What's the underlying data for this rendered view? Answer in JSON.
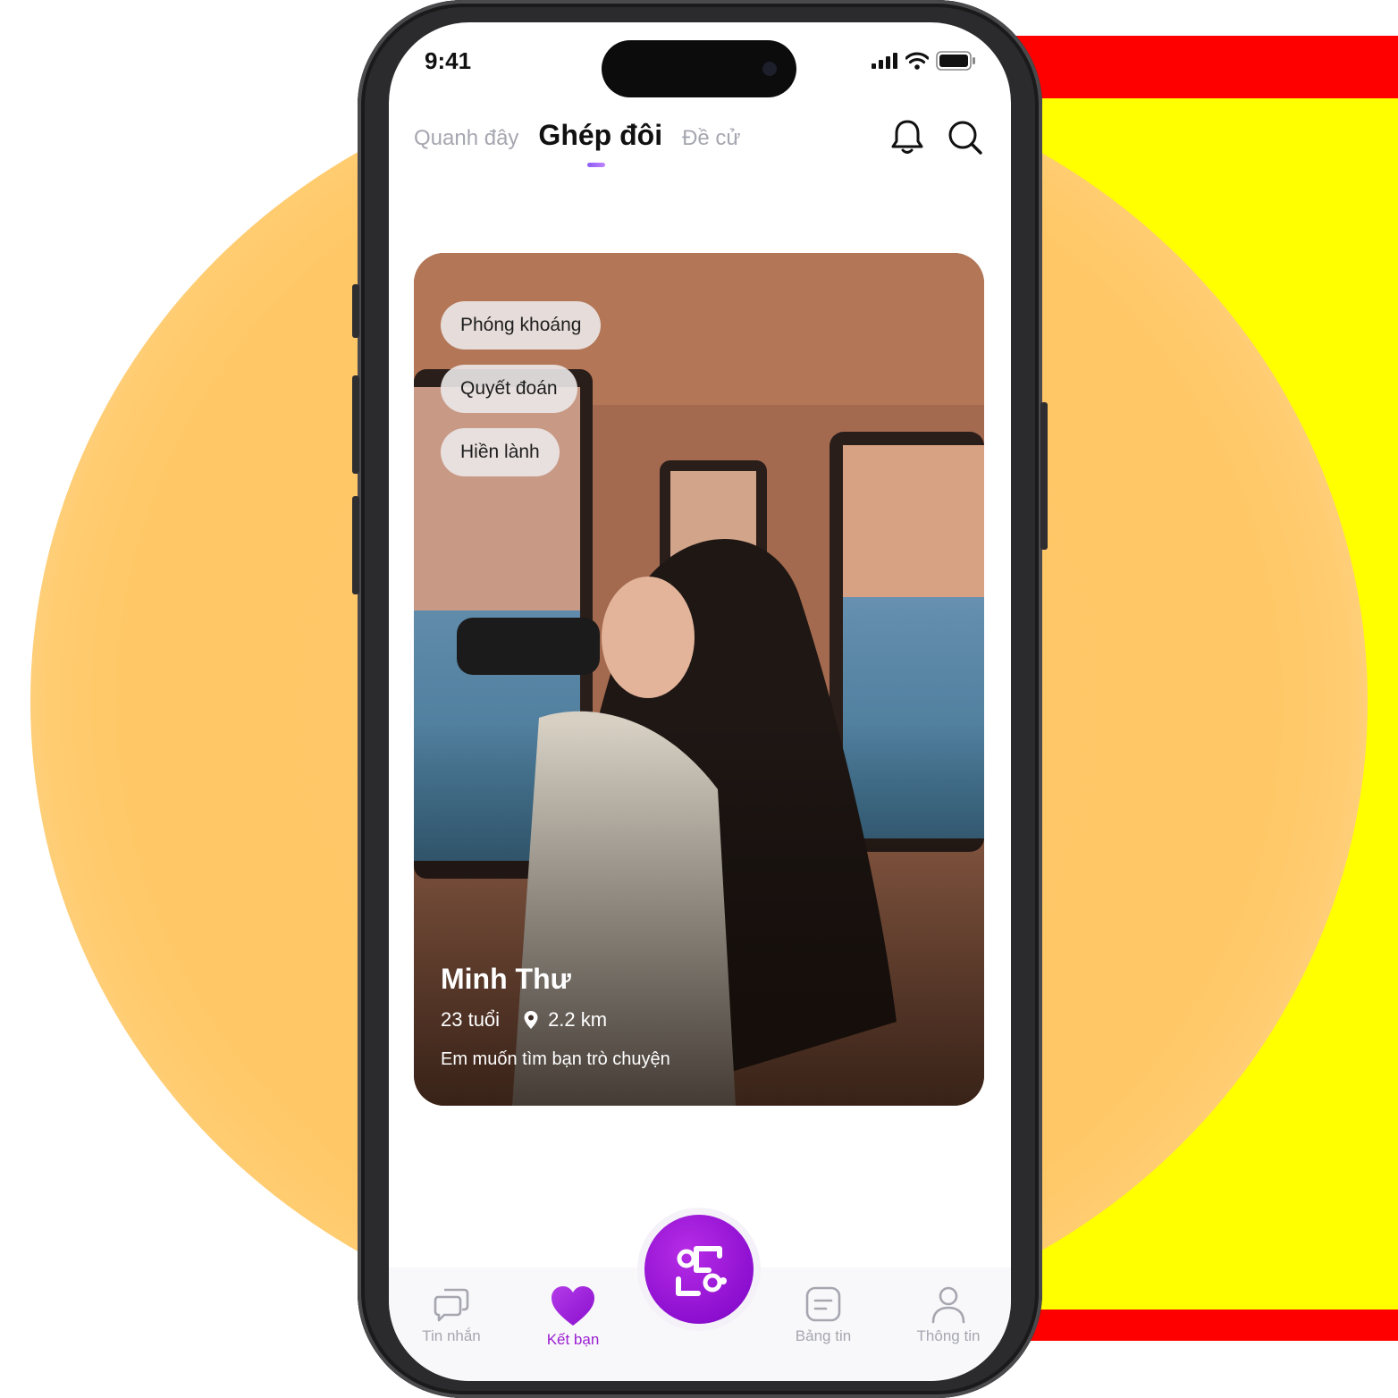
{
  "status_bar": {
    "time": "9:41"
  },
  "header": {
    "tabs": [
      {
        "label": "Quanh đây"
      },
      {
        "label": "Ghép đôi",
        "active": true
      },
      {
        "label": "Đề cử"
      }
    ],
    "icons": [
      "bell-icon",
      "search-icon"
    ]
  },
  "profile": {
    "traits": [
      "Phóng khoáng",
      "Quyết đoán",
      "Hiền lành"
    ],
    "name": "Minh Thư",
    "age": "23 tuổi",
    "distance": "2.2 km",
    "bio": "Em muốn tìm bạn trò chuyện"
  },
  "bottom_nav": {
    "items": [
      {
        "label": "Tin nhắn",
        "icon": "chat-icon"
      },
      {
        "label": "Kết bạn",
        "icon": "heart-icon",
        "active": true
      },
      {
        "label": "Bảng tin",
        "icon": "feed-icon"
      },
      {
        "label": "Thông tin",
        "icon": "user-icon"
      }
    ],
    "center_button_icon": "match-icon"
  },
  "colors": {
    "accent": "#9b1fd1",
    "center_button": "#8d0fd0",
    "inactive": "#a6a6b0",
    "background_circle": "#ffc766"
  }
}
